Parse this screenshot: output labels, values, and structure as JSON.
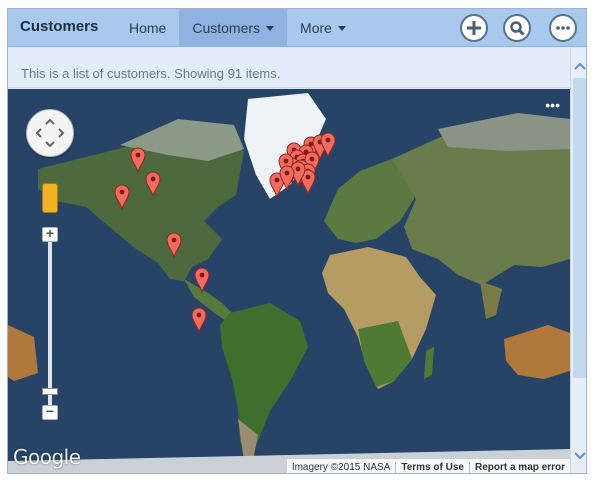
{
  "header": {
    "title": "Customers",
    "nav": [
      {
        "label": "Home",
        "active": false,
        "has_menu": false
      },
      {
        "label": "Customers",
        "active": true,
        "has_menu": true
      },
      {
        "label": "More",
        "active": false,
        "has_menu": true
      }
    ],
    "actions": [
      {
        "name": "add-icon"
      },
      {
        "name": "search-icon"
      },
      {
        "name": "more-icon"
      }
    ]
  },
  "info": {
    "text": "This is a list of customers. Showing 91 items."
  },
  "map": {
    "logo": "Google",
    "attribution": {
      "imagery": "Imagery ©2015 NASA",
      "terms": "Terms of Use",
      "report": "Report a map error"
    },
    "markers": [
      {
        "lat": 53,
        "lng": -97
      },
      {
        "lat": 41,
        "lng": -87
      },
      {
        "lat": 34,
        "lng": -107
      },
      {
        "lat": 9,
        "lng": -74
      },
      {
        "lat": -9,
        "lng": -56
      },
      {
        "lat": -30,
        "lng": -58
      },
      {
        "lat": 40,
        "lng": -8
      },
      {
        "lat": 56,
        "lng": 3
      },
      {
        "lat": 59,
        "lng": 14
      },
      {
        "lat": 60,
        "lng": 20
      },
      {
        "lat": 61,
        "lng": 25
      },
      {
        "lat": 55,
        "lng": 11
      },
      {
        "lat": 52,
        "lng": 5
      },
      {
        "lat": 50,
        "lng": 9
      },
      {
        "lat": 51,
        "lng": 15
      },
      {
        "lat": 48,
        "lng": 2
      },
      {
        "lat": 47,
        "lng": 8
      },
      {
        "lat": 45,
        "lng": 12
      },
      {
        "lat": 42,
        "lng": 12
      },
      {
        "lat": 46,
        "lng": 6
      },
      {
        "lat": 50,
        "lng": -2
      },
      {
        "lat": 44,
        "lng": -1
      }
    ]
  },
  "colors": {
    "header": "#a9c8ee",
    "active_tab": "#8fb2e0",
    "marker": "#f36a5f",
    "ocean": "#274466"
  }
}
